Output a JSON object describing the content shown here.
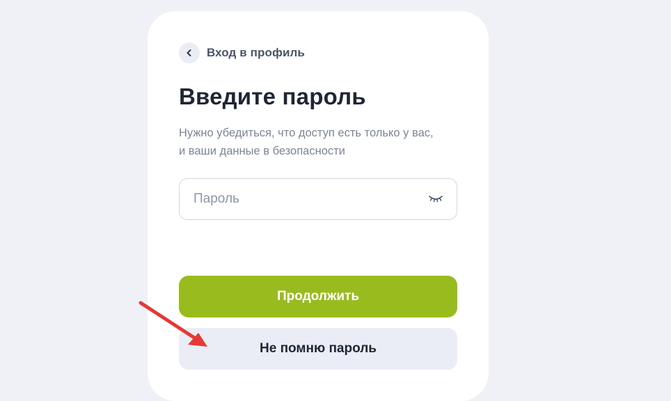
{
  "header": {
    "back_label": "Вход в профиль"
  },
  "main": {
    "title": "Введите пароль",
    "subtitle_line1": "Нужно убедиться, что доступ есть только у вас,",
    "subtitle_line2": "и ваши данные в безопасности"
  },
  "password": {
    "placeholder": "Пароль",
    "value": "",
    "toggle_icon": "eye-closed-icon"
  },
  "actions": {
    "continue_label": "Продолжить",
    "forgot_label": "Не помню пароль"
  },
  "annotation": {
    "arrow_color": "#e53935"
  },
  "colors": {
    "accent": "#98bc1e",
    "background": "#eff1f6"
  }
}
